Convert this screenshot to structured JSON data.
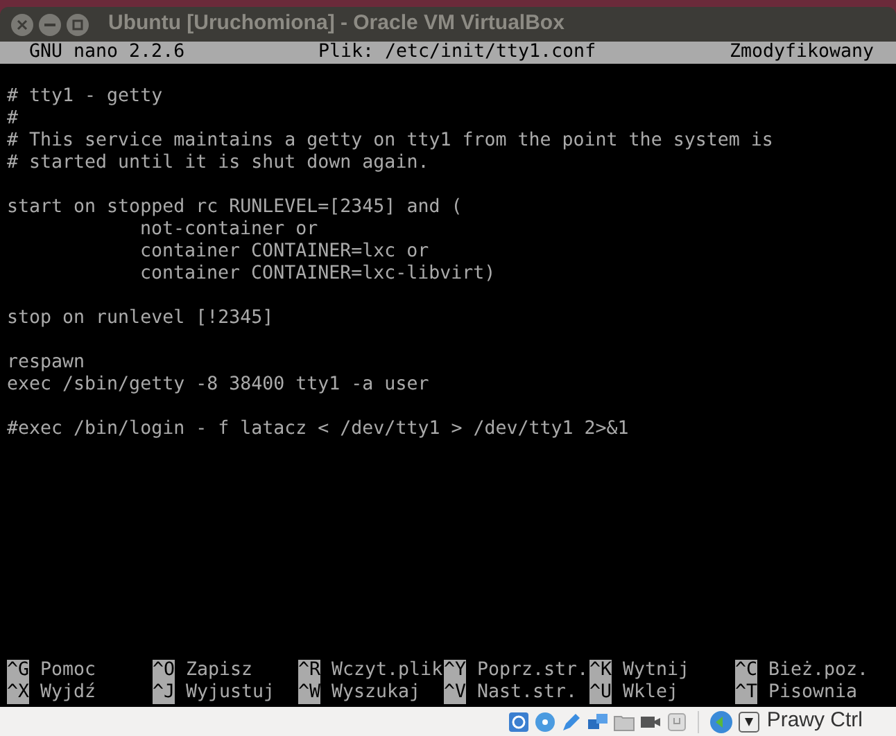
{
  "window": {
    "title": "Ubuntu [Uruchomiona] - Oracle VM VirtualBox"
  },
  "nano_header": {
    "version": "GNU nano 2.2.6",
    "file": "Plik: /etc/init/tty1.conf",
    "status": "Zmodyfikowany"
  },
  "blocks": [
    {
      "lines": [
        {
          "text": "# tty1 - getty"
        },
        {
          "text": "#"
        },
        {
          "text": "# This service maintains a getty on tty1 from the point the system is"
        },
        {
          "text": "# started until it is shut down again."
        }
      ]
    },
    {
      "lines": [
        {
          "text": "start on stopped rc RUNLEVEL=[2345] and (",
          "children": [
            {
              "text": "not-container or"
            },
            {
              "text": "container CONTAINER=lxc or"
            },
            {
              "text": "container CONTAINER=lxc-libvirt)"
            }
          ]
        }
      ]
    },
    {
      "lines": [
        {
          "text": "stop on runlevel [!2345]"
        }
      ]
    },
    {
      "lines": [
        {
          "text": "respawn"
        },
        {
          "text": "exec /sbin/getty -8 38400 tty1 -a user"
        }
      ]
    },
    {
      "lines": [
        {
          "text": "#exec /bin/login - f latacz < /dev/tty1 > /dev/tty1 2>&1"
        }
      ]
    }
  ],
  "shortcuts": [
    {
      "key": "^G",
      "label": "Pomoc"
    },
    {
      "key": "^O",
      "label": "Zapisz"
    },
    {
      "key": "^R",
      "label": "Wczyt.plik"
    },
    {
      "key": "^Y",
      "label": "Poprz.str."
    },
    {
      "key": "^K",
      "label": "Wytnij"
    },
    {
      "key": "^C",
      "label": "Bież.poz."
    },
    {
      "key": "^X",
      "label": "Wyjdź"
    },
    {
      "key": "^J",
      "label": "Wyjustuj"
    },
    {
      "key": "^W",
      "label": "Wyszukaj"
    },
    {
      "key": "^V",
      "label": "Nast.str."
    },
    {
      "key": "^U",
      "label": "Wklej"
    },
    {
      "key": "^T",
      "label": "Pisownia"
    }
  ],
  "status_bar": {
    "host_key": "Prawy Ctrl"
  }
}
